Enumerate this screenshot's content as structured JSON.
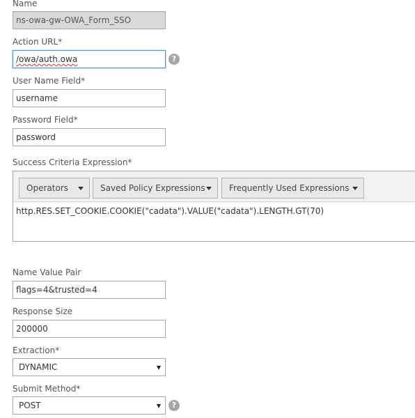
{
  "form": {
    "name": {
      "label": "Name",
      "value": "ns-owa-gw-OWA_Form_SSO"
    },
    "action_url": {
      "label": "Action URL*",
      "value": "/owa/auth.owa",
      "help_icon": "question-circle-icon",
      "help_glyph": "?"
    },
    "user_name_field": {
      "label": "User Name Field*",
      "value": "username"
    },
    "password_field": {
      "label": "Password Field*",
      "value": "password"
    },
    "success_criteria": {
      "label": "Success Criteria Expression*",
      "toolbar": {
        "operators": "Operators",
        "saved_policy_expressions": "Saved Policy Expressions",
        "frequently_used_expressions": "Frequently Used Expressions"
      },
      "expression": "http.RES.SET_COOKIE.COOKIE(\"cadata\").VALUE(\"cadata\").LENGTH.GT(70)"
    },
    "name_value_pair": {
      "label": "Name Value Pair",
      "value": "flags=4&trusted=4"
    },
    "response_size": {
      "label": "Response Size",
      "value": "200000"
    },
    "extraction": {
      "label": "Extraction*",
      "selected": "DYNAMIC"
    },
    "submit_method": {
      "label": "Submit Method*",
      "selected": "POST",
      "help_icon": "question-circle-icon",
      "help_glyph": "?"
    }
  },
  "colors": {
    "disabled_field": "#d9d9d9",
    "focus_border": "#4a90d9",
    "help_icon": "#a6a6a6",
    "toolbar_bg": "#f2f2f2",
    "spellcheck_underline": "#d32f2f"
  }
}
